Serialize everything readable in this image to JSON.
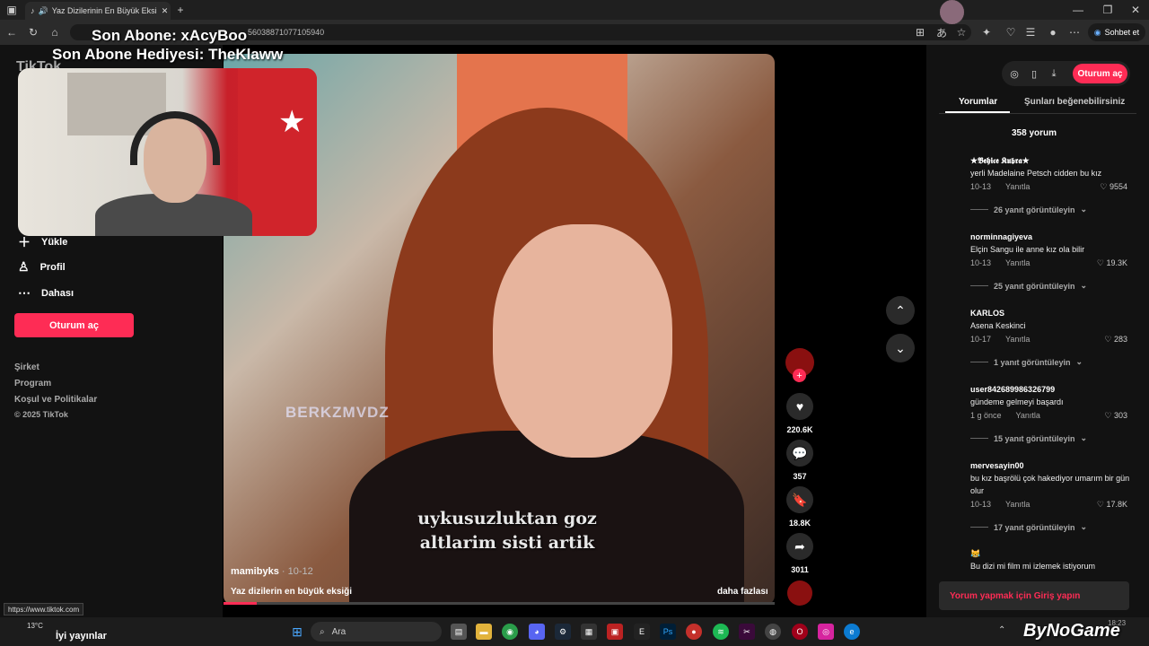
{
  "browser": {
    "tab_title": "Yaz Dizilerinin En Büyük Eksi",
    "url_suffix": "56038871077105940",
    "chat_button": "Sohbet et"
  },
  "stream_overlay": {
    "last_sub": "Son Abone: xAcyBoo",
    "last_gift": "Son Abone Hediyesi: TheKlaww"
  },
  "left_nav": {
    "logo": "TikTok",
    "items": [
      {
        "label": "Yükle"
      },
      {
        "label": "Profil"
      },
      {
        "label": "Dahası"
      }
    ],
    "login_button": "Oturum aç",
    "footer_links": [
      "Şirket",
      "Program",
      "Koşul ve Politikalar"
    ],
    "copyright": "© 2025 TikTok"
  },
  "video": {
    "watermark": "BERKZMVDZ",
    "caption_line1": "uykusuzluktan goz",
    "caption_line2": "altlarim sisti artik",
    "author": "mamibyks",
    "date": "· 10-12",
    "description": "Yaz dizilerin en büyük eksiği",
    "more": "daha fazlası"
  },
  "actions": {
    "likes": "220.6K",
    "comments": "357",
    "saves": "18.8K",
    "shares": "3011"
  },
  "right_panel": {
    "login_button": "Oturum aç",
    "tabs": [
      "Yorumlar",
      "Şunları beğenebilirsiniz"
    ],
    "comment_count": "358 yorum",
    "comments": [
      {
        "name": "★𝕭𝖊𝖍𝖎𝖈𝖊 𝕶𝖚𝖇𝖗𝖆★",
        "text": "yerli Madelaine Petsch cidden bu kız",
        "date": "10-13",
        "reply": "Yanıtla",
        "likes": "9554",
        "replies": "26 yanıt görüntüleyin"
      },
      {
        "name": "norminnagiyeva",
        "text": "Elçin Sangu ile anne kız ola bilir",
        "date": "10-13",
        "reply": "Yanıtla",
        "likes": "19.3K",
        "replies": "25 yanıt görüntüleyin"
      },
      {
        "name": "KARLOS",
        "text": "Asena Keskinci",
        "date": "10-17",
        "reply": "Yanıtla",
        "likes": "283",
        "replies": "1 yanıt görüntüleyin"
      },
      {
        "name": "user842689986326799",
        "text": "gündeme gelmeyi başardı",
        "date": "1 g önce",
        "reply": "Yanıtla",
        "likes": "303",
        "replies": "15 yanıt görüntüleyin"
      },
      {
        "name": "mervesayin00",
        "text": "bu kız başrölü çok hakediyor umarım bir gün olur",
        "date": "10-13",
        "reply": "Yanıtla",
        "likes": "17.8K",
        "replies": "17 yanıt görüntüleyin"
      },
      {
        "name": "😹",
        "text": "Bu dizi mi film mi izlemek istiyorum",
        "date": "",
        "reply": "",
        "likes": "",
        "replies": ""
      }
    ],
    "comment_prompt": "Yorum yapmak için Giriş yapın"
  },
  "status_url": "https://www.tiktok.com",
  "taskbar": {
    "weather": "13°C",
    "news": "İyi yayınlar",
    "search_placeholder": "Ara",
    "brand": "ByNoGame",
    "time": "18:23"
  },
  "colors": {
    "accent": "#fe2c55",
    "panel": "#121212"
  }
}
